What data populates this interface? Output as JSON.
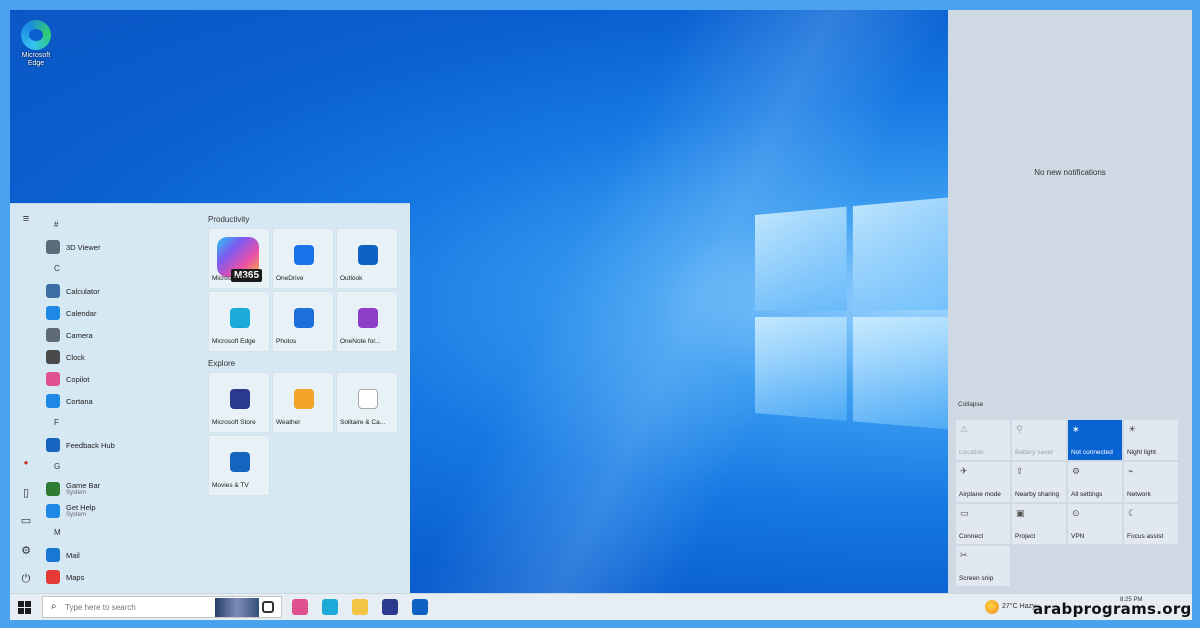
{
  "desktop": {
    "icons": [
      {
        "label": "Microsoft Edge",
        "icon": "edge-icon"
      }
    ]
  },
  "start_menu": {
    "rail": [
      "hamburger-icon",
      "user-icon",
      "documents-icon",
      "pictures-icon",
      "settings-icon",
      "power-icon"
    ],
    "app_list": [
      {
        "type": "letter",
        "text": "#"
      },
      {
        "type": "app",
        "name": "3D Viewer",
        "icon": "3d-viewer-icon",
        "color": "#5b6b7a"
      },
      {
        "type": "letter",
        "text": "C"
      },
      {
        "type": "app",
        "name": "Calculator",
        "icon": "calculator-icon",
        "color": "#3a6ea5"
      },
      {
        "type": "app",
        "name": "Calendar",
        "icon": "calendar-icon",
        "color": "#1e88e5"
      },
      {
        "type": "app",
        "name": "Camera",
        "icon": "camera-icon",
        "color": "#5f6b75"
      },
      {
        "type": "app",
        "name": "Clock",
        "icon": "clock-icon",
        "color": "#4a4a4a"
      },
      {
        "type": "app",
        "name": "Copilot",
        "icon": "copilot-icon",
        "color": "#e0508f"
      },
      {
        "type": "app",
        "name": "Cortana",
        "icon": "cortana-icon",
        "color": "#1e88e5"
      },
      {
        "type": "letter",
        "text": "F"
      },
      {
        "type": "app",
        "name": "Feedback Hub",
        "icon": "feedback-hub-icon",
        "color": "#1565c0"
      },
      {
        "type": "letter",
        "text": "G"
      },
      {
        "type": "app",
        "name": "Game Bar",
        "sub": "System",
        "icon": "game-bar-icon",
        "color": "#2e7d32"
      },
      {
        "type": "app",
        "name": "Get Help",
        "sub": "System",
        "icon": "get-help-icon",
        "color": "#1e88e5"
      },
      {
        "type": "letter",
        "text": "M"
      },
      {
        "type": "app",
        "name": "Mail",
        "icon": "mail-icon",
        "color": "#1976d2"
      },
      {
        "type": "app",
        "name": "Maps",
        "icon": "maps-icon",
        "color": "#e53935"
      }
    ],
    "sections": [
      {
        "title": "Productivity",
        "tiles": [
          {
            "name": "Microsoft 365",
            "icon": "m365-icon",
            "badge": "M365",
            "big": true,
            "color": "linear-gradient(135deg,#2bc4f5,#7b5cf0,#e94fa7,#f5b83d)"
          },
          {
            "name": "OneDrive",
            "icon": "onedrive-icon",
            "color": "#1a73e8"
          },
          {
            "name": "Outlook",
            "icon": "outlook-icon",
            "color": "#0f62c4"
          },
          {
            "name": "Microsoft Edge",
            "icon": "edge-icon",
            "color": "#1cabd8"
          },
          {
            "name": "Photos",
            "icon": "photos-icon",
            "color": "#1e6fd9"
          },
          {
            "name": "OneNote for...",
            "icon": "onenote-icon",
            "color": "#8e3fc9"
          }
        ]
      },
      {
        "title": "Explore",
        "tiles": [
          {
            "name": "Microsoft Store",
            "icon": "store-icon",
            "color": "#2b3a8c"
          },
          {
            "name": "Weather",
            "icon": "weather-icon",
            "color": "#f2a32a"
          },
          {
            "name": "Solitaire & Ca...",
            "icon": "solitaire-icon",
            "color": "#ffffff"
          },
          {
            "name": "Movies & TV",
            "icon": "movies-tv-icon",
            "color": "#1565c0"
          }
        ]
      }
    ]
  },
  "action_center": {
    "no_notifications": "No new notifications",
    "collapse": "Collapse",
    "quick_actions": [
      {
        "label": "Location",
        "icon": "location-icon",
        "glyph": "⚠",
        "state": "dim"
      },
      {
        "label": "Battery saver",
        "icon": "battery-saver-icon",
        "glyph": "⚲",
        "state": "dim"
      },
      {
        "label": "Not connected",
        "icon": "bluetooth-icon",
        "glyph": "∗",
        "state": "on"
      },
      {
        "label": "Night light",
        "icon": "night-light-icon",
        "glyph": "☀",
        "state": "off"
      },
      {
        "label": "Airplane mode",
        "icon": "airplane-icon",
        "glyph": "✈",
        "state": "off"
      },
      {
        "label": "Nearby sharing",
        "icon": "nearby-sharing-icon",
        "glyph": "⇪",
        "state": "off"
      },
      {
        "label": "All settings",
        "icon": "settings-icon",
        "glyph": "⚙",
        "state": "off"
      },
      {
        "label": "Network",
        "icon": "network-icon",
        "glyph": "⌁",
        "state": "off"
      },
      {
        "label": "Connect",
        "icon": "connect-icon",
        "glyph": "▭",
        "state": "off"
      },
      {
        "label": "Project",
        "icon": "project-icon",
        "glyph": "▣",
        "state": "off"
      },
      {
        "label": "VPN",
        "icon": "vpn-icon",
        "glyph": "⊙",
        "state": "off"
      },
      {
        "label": "Focus assist",
        "icon": "focus-assist-icon",
        "glyph": "☾",
        "state": "off"
      },
      {
        "label": "Screen snip",
        "icon": "screen-snip-icon",
        "glyph": "✂",
        "state": "off"
      }
    ]
  },
  "taskbar": {
    "search_placeholder": "Type here to search",
    "apps": [
      {
        "name": "task-view-icon",
        "color": "#333333"
      },
      {
        "name": "copilot-icon",
        "color": "#e0508f"
      },
      {
        "name": "edge-icon",
        "color": "#1cabd8"
      },
      {
        "name": "file-explorer-icon",
        "color": "#f4c542"
      },
      {
        "name": "store-icon",
        "color": "#2b3a8c"
      },
      {
        "name": "outlook-icon",
        "color": "#0f62c4"
      }
    ],
    "weather": "27°C  Hazy",
    "clock_time": "8:25 PM"
  },
  "watermark": "arabprograms.org"
}
